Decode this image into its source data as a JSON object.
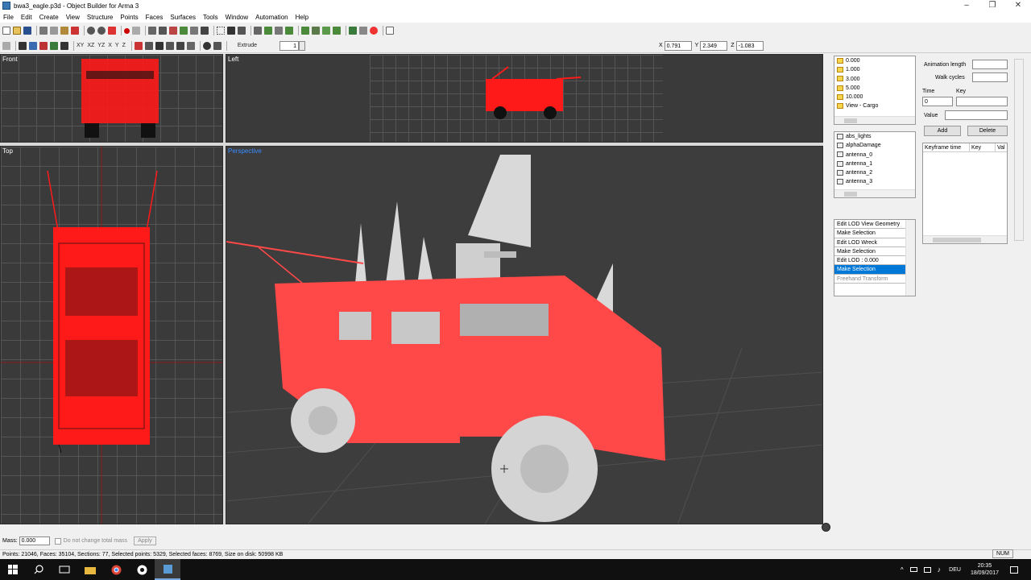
{
  "window": {
    "title": "bwa3_eagle.p3d - Object Builder for Arma 3",
    "minimize": "–",
    "maximize": "❐",
    "close": "✕"
  },
  "menu": [
    "File",
    "Edit",
    "Create",
    "View",
    "Structure",
    "Points",
    "Faces",
    "Surfaces",
    "Tools",
    "Window",
    "Automation",
    "Help"
  ],
  "toolbar2": {
    "extrude_label": "Extrude",
    "extrude_value": "1"
  },
  "coords": {
    "x_label": "X",
    "x": "0.791",
    "y_label": "Y",
    "y": "2.349",
    "z_label": "Z",
    "z": "-1.083"
  },
  "viewports": {
    "front": "Front",
    "left": "Left",
    "top": "Top",
    "perspective": "Perspective"
  },
  "lods": {
    "items": [
      "0.000",
      "1.000",
      "3.000",
      "5.000",
      "10.000",
      "View - Cargo"
    ]
  },
  "selections": {
    "items": [
      "abs_lights",
      "alphaDamage",
      "antenna_0",
      "antenna_1",
      "antenna_2",
      "antenna_3"
    ]
  },
  "history": {
    "items": [
      "Edit LOD View Geometry",
      "Make Selection",
      "Edit LOD Wreck",
      "Make Selection",
      "Edit LOD : 0.000",
      "Make Selection",
      "Freehand Transform"
    ],
    "active_index": 5
  },
  "animation": {
    "length_label": "Animation length",
    "walk_label": "Walk cycles",
    "time_label": "Time",
    "key_label": "Key",
    "time_value": "0",
    "value_label": "Value",
    "add": "Add",
    "delete": "Delete",
    "columns": [
      "Keyframe time",
      "Key",
      "Val"
    ]
  },
  "mass": {
    "label": "Mass:",
    "value": "0.000",
    "checkbox": "Do not change total mass",
    "apply": "Apply"
  },
  "status": {
    "text": "Points: 21046, Faces: 35104, Sections: 77, Selected points: 5329, Selected faces: 8769, Size on disk: 50998 KB",
    "num": "NUM"
  },
  "taskbar": {
    "lang": "DEU",
    "time": "20:35",
    "date": "18/09/2017"
  },
  "colors": {
    "accent": "#0078d7",
    "model": "#ff4848",
    "wire": "#ff0000",
    "viewport_bg": "#3a3a3a"
  }
}
